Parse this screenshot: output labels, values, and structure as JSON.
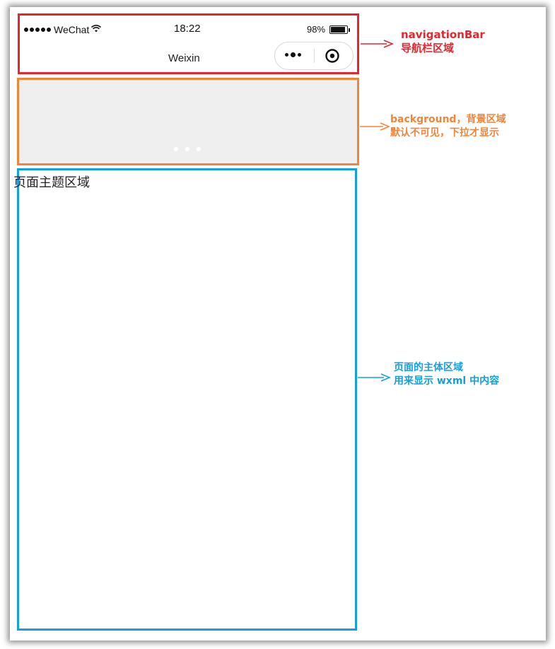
{
  "status_bar": {
    "carrier": "WeChat",
    "time": "18:22",
    "battery": "98%",
    "battery_level": 0.98
  },
  "navigation": {
    "title": "Weixin"
  },
  "page": {
    "body_text": "页面主题区域"
  },
  "annotations": {
    "navigation_bar": {
      "line1": "navigationBar",
      "line2": "导航栏区域",
      "color": "#e5262e"
    },
    "background": {
      "line1": "background，背景区域",
      "line2": "默认不可见，下拉才显示",
      "color": "#f0853a"
    },
    "page_body": {
      "line1": "页面的主体区域",
      "line2": "用来显示 wxml 中内容",
      "color": "#14a0df"
    }
  }
}
